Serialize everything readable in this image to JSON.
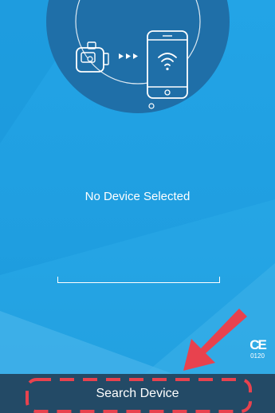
{
  "pairing": {
    "status_text": "No Device Selected",
    "progress": 0
  },
  "footer": {
    "search_label": "Search Device",
    "ce_mark": "CE",
    "ce_number": "0120"
  },
  "colors": {
    "background": "#1f9ee0",
    "hero_circle": "#1f6fa8",
    "bottom_bar": "#234a66",
    "annotation_red": "#e8424e"
  },
  "icons": {
    "meter": "glucose-meter-icon",
    "phone": "smartphone-icon",
    "wifi": "wifi-icon",
    "arrows": "transfer-arrows-icon"
  }
}
